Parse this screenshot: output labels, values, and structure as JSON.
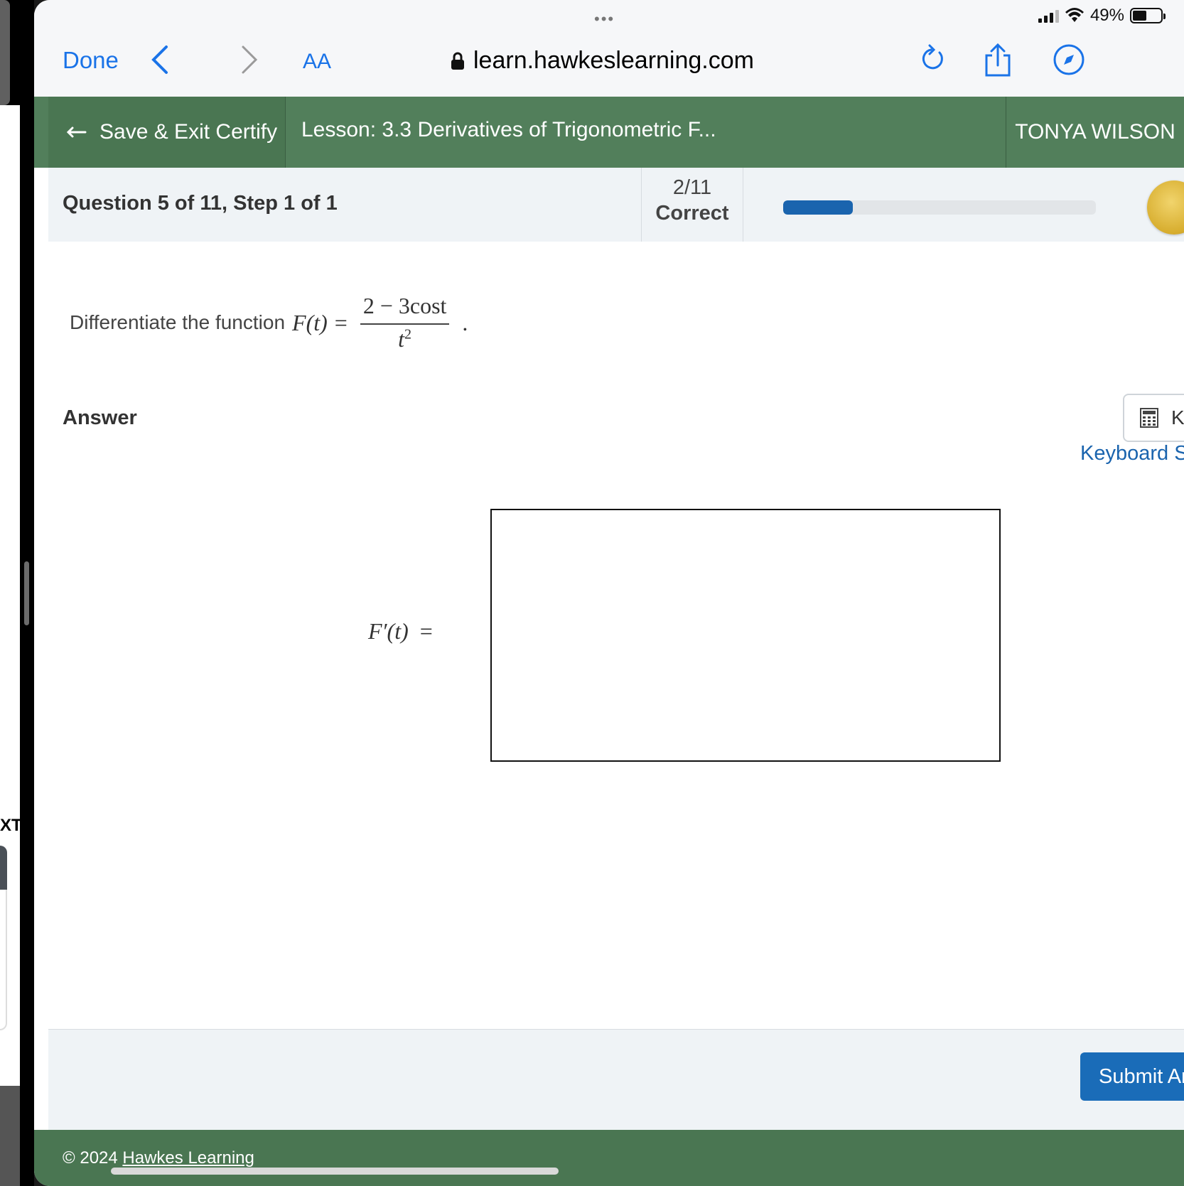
{
  "status_bar": {
    "dots": "•••",
    "battery_text": "49%",
    "battery_level": 0.49
  },
  "browser": {
    "done_label": "Done",
    "text_size_label": "AA",
    "url": "learn.hawkeslearning.com"
  },
  "top_bar": {
    "save_exit_label": "Save & Exit Certify",
    "lesson_title": "Lesson: 3.3 Derivatives of Trigonometric F...",
    "user_name": "TONYA WILSON"
  },
  "question_header": {
    "title": "Question 5 of 11, Step 1 of 1",
    "score": "2/11",
    "score_label": "Correct",
    "progress_fraction": 0.2222
  },
  "question": {
    "prompt_text": "Differentiate the function",
    "function_lhs": "F(t)",
    "equals": "=",
    "numerator": "2 − 3cost",
    "denominator_base": "t",
    "denominator_exp": "2",
    "end_period": "."
  },
  "answer": {
    "label": "Answer",
    "keyboard_button_text": "K",
    "keyboard_link": "Keyboard S",
    "lhs": "F′(t)",
    "equals": "="
  },
  "actions": {
    "submit_label": "Submit Ar"
  },
  "footer": {
    "copyright_symbol": "©",
    "copyright_year": "2024",
    "company_link": "Hawkes Learning"
  },
  "side_panel": {
    "partial_text": "XT"
  },
  "colors": {
    "green_bar": "#527f5b",
    "progress_blue": "#1a64ae",
    "submit_blue": "#1a6cb8",
    "link_blue": "#1a73e8"
  }
}
